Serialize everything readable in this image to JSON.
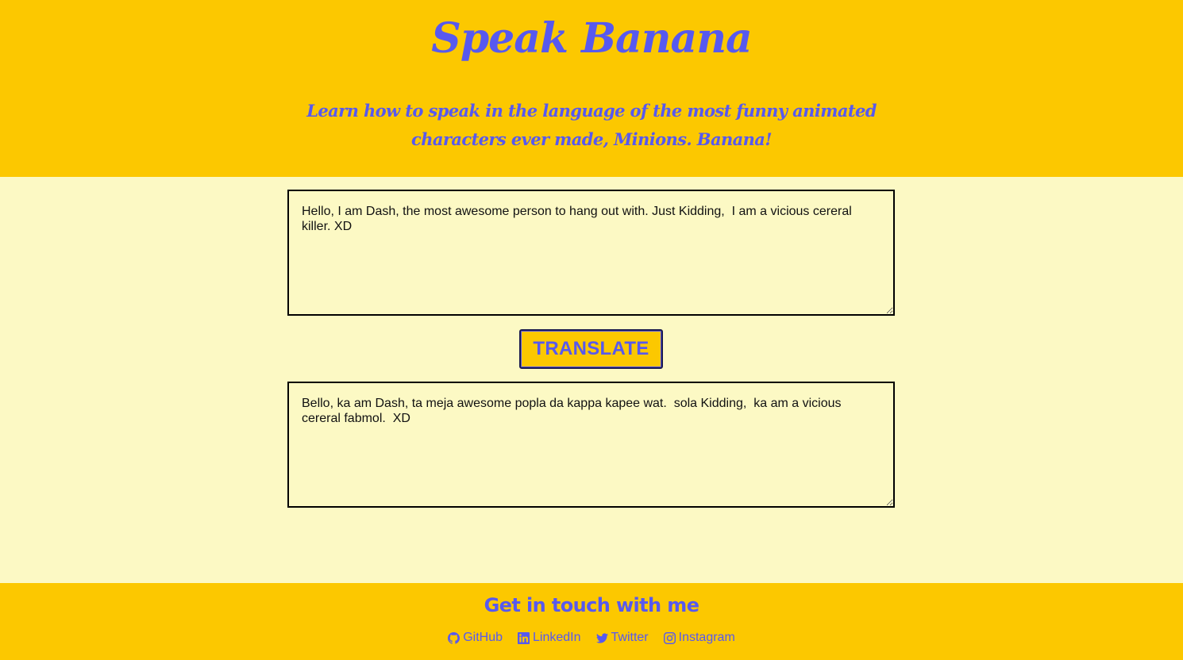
{
  "header": {
    "title": "Speak Banana",
    "subtitle": "Learn how to speak in the language of the most funny animated characters ever made, Minions. Banana!"
  },
  "translator": {
    "input_text": "Hello, I am Dash, the most awesome person to hang out with. Just Kidding,  I am a vicious cereral killer. XD",
    "button_label": "TRANSLATE",
    "output_text": "Bello, ka am Dash, ta meja awesome popla da kappa kapee wat.  sola Kidding,  ka am a vicious cereral fabmol.  XD"
  },
  "footer": {
    "heading": "Get in touch with me",
    "links": [
      {
        "label": "GitHub",
        "icon": "github-icon"
      },
      {
        "label": "LinkedIn",
        "icon": "linkedin-icon"
      },
      {
        "label": "Twitter",
        "icon": "twitter-icon"
      },
      {
        "label": "Instagram",
        "icon": "instagram-icon"
      }
    ]
  },
  "colors": {
    "header_bg": "#fcc800",
    "page_bg": "#fcf9c4",
    "accent": "#5759ef"
  }
}
